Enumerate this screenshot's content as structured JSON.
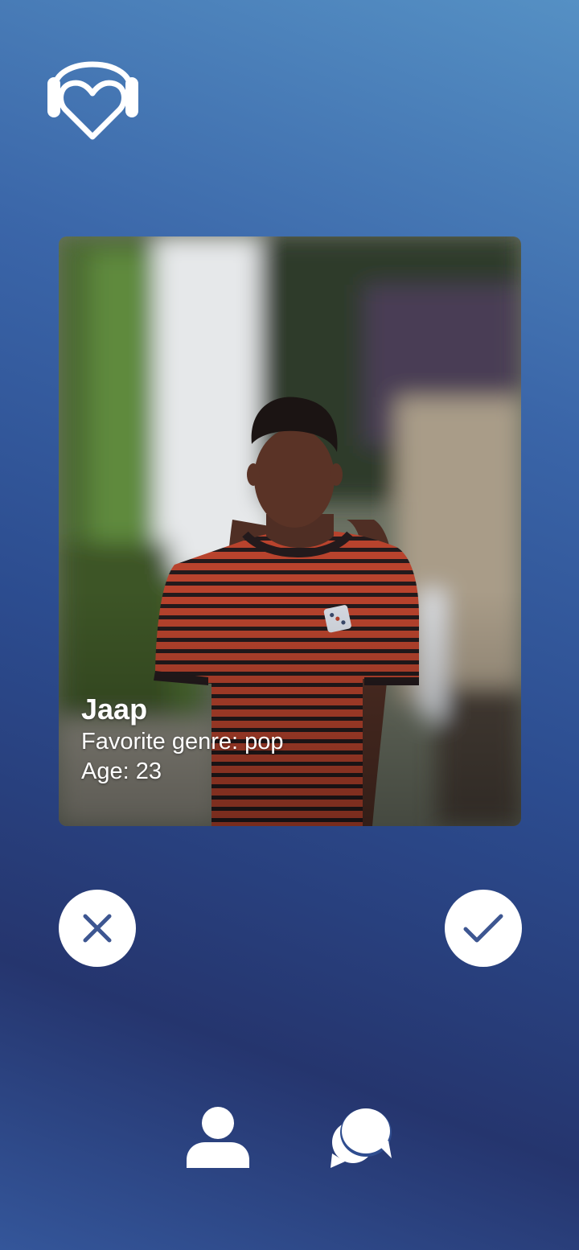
{
  "app": {
    "logo_icon": "heart-headphones-icon"
  },
  "profile_card": {
    "photo_subject": "man-in-striped-shirt",
    "name": "Jaap",
    "genre_line": "Favorite genre: pop",
    "age_line": "Age: 23"
  },
  "actions": {
    "reject_icon": "close-icon",
    "accept_icon": "check-icon",
    "icon_color": "#3d5691"
  },
  "bottom_nav": {
    "items": [
      {
        "icon": "user-icon"
      },
      {
        "icon": "chat-bubbles-icon"
      }
    ],
    "icon_color": "#ffffff"
  }
}
